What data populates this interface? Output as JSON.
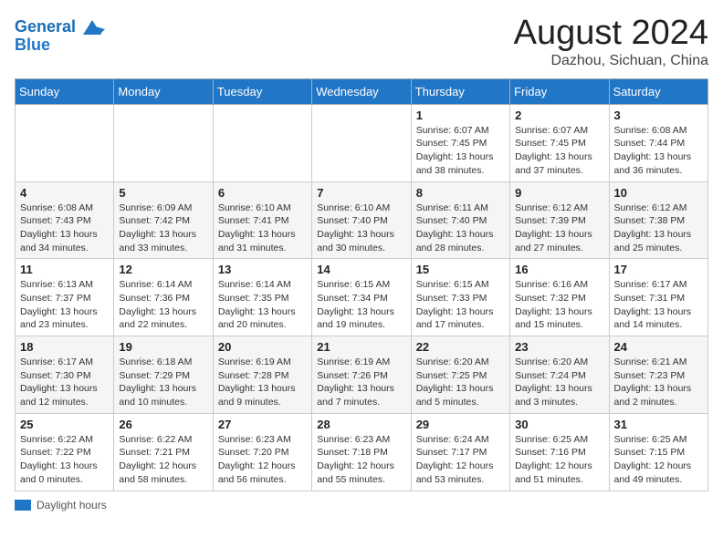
{
  "header": {
    "logo_line1": "General",
    "logo_line2": "Blue",
    "main_title": "August 2024",
    "subtitle": "Dazhou, Sichuan, China"
  },
  "days_of_week": [
    "Sunday",
    "Monday",
    "Tuesday",
    "Wednesday",
    "Thursday",
    "Friday",
    "Saturday"
  ],
  "weeks": [
    [
      {
        "day": "",
        "info": ""
      },
      {
        "day": "",
        "info": ""
      },
      {
        "day": "",
        "info": ""
      },
      {
        "day": "",
        "info": ""
      },
      {
        "day": "1",
        "info": "Sunrise: 6:07 AM\nSunset: 7:45 PM\nDaylight: 13 hours and 38 minutes."
      },
      {
        "day": "2",
        "info": "Sunrise: 6:07 AM\nSunset: 7:45 PM\nDaylight: 13 hours and 37 minutes."
      },
      {
        "day": "3",
        "info": "Sunrise: 6:08 AM\nSunset: 7:44 PM\nDaylight: 13 hours and 36 minutes."
      }
    ],
    [
      {
        "day": "4",
        "info": "Sunrise: 6:08 AM\nSunset: 7:43 PM\nDaylight: 13 hours and 34 minutes."
      },
      {
        "day": "5",
        "info": "Sunrise: 6:09 AM\nSunset: 7:42 PM\nDaylight: 13 hours and 33 minutes."
      },
      {
        "day": "6",
        "info": "Sunrise: 6:10 AM\nSunset: 7:41 PM\nDaylight: 13 hours and 31 minutes."
      },
      {
        "day": "7",
        "info": "Sunrise: 6:10 AM\nSunset: 7:40 PM\nDaylight: 13 hours and 30 minutes."
      },
      {
        "day": "8",
        "info": "Sunrise: 6:11 AM\nSunset: 7:40 PM\nDaylight: 13 hours and 28 minutes."
      },
      {
        "day": "9",
        "info": "Sunrise: 6:12 AM\nSunset: 7:39 PM\nDaylight: 13 hours and 27 minutes."
      },
      {
        "day": "10",
        "info": "Sunrise: 6:12 AM\nSunset: 7:38 PM\nDaylight: 13 hours and 25 minutes."
      }
    ],
    [
      {
        "day": "11",
        "info": "Sunrise: 6:13 AM\nSunset: 7:37 PM\nDaylight: 13 hours and 23 minutes."
      },
      {
        "day": "12",
        "info": "Sunrise: 6:14 AM\nSunset: 7:36 PM\nDaylight: 13 hours and 22 minutes."
      },
      {
        "day": "13",
        "info": "Sunrise: 6:14 AM\nSunset: 7:35 PM\nDaylight: 13 hours and 20 minutes."
      },
      {
        "day": "14",
        "info": "Sunrise: 6:15 AM\nSunset: 7:34 PM\nDaylight: 13 hours and 19 minutes."
      },
      {
        "day": "15",
        "info": "Sunrise: 6:15 AM\nSunset: 7:33 PM\nDaylight: 13 hours and 17 minutes."
      },
      {
        "day": "16",
        "info": "Sunrise: 6:16 AM\nSunset: 7:32 PM\nDaylight: 13 hours and 15 minutes."
      },
      {
        "day": "17",
        "info": "Sunrise: 6:17 AM\nSunset: 7:31 PM\nDaylight: 13 hours and 14 minutes."
      }
    ],
    [
      {
        "day": "18",
        "info": "Sunrise: 6:17 AM\nSunset: 7:30 PM\nDaylight: 13 hours and 12 minutes."
      },
      {
        "day": "19",
        "info": "Sunrise: 6:18 AM\nSunset: 7:29 PM\nDaylight: 13 hours and 10 minutes."
      },
      {
        "day": "20",
        "info": "Sunrise: 6:19 AM\nSunset: 7:28 PM\nDaylight: 13 hours and 9 minutes."
      },
      {
        "day": "21",
        "info": "Sunrise: 6:19 AM\nSunset: 7:26 PM\nDaylight: 13 hours and 7 minutes."
      },
      {
        "day": "22",
        "info": "Sunrise: 6:20 AM\nSunset: 7:25 PM\nDaylight: 13 hours and 5 minutes."
      },
      {
        "day": "23",
        "info": "Sunrise: 6:20 AM\nSunset: 7:24 PM\nDaylight: 13 hours and 3 minutes."
      },
      {
        "day": "24",
        "info": "Sunrise: 6:21 AM\nSunset: 7:23 PM\nDaylight: 13 hours and 2 minutes."
      }
    ],
    [
      {
        "day": "25",
        "info": "Sunrise: 6:22 AM\nSunset: 7:22 PM\nDaylight: 13 hours and 0 minutes."
      },
      {
        "day": "26",
        "info": "Sunrise: 6:22 AM\nSunset: 7:21 PM\nDaylight: 12 hours and 58 minutes."
      },
      {
        "day": "27",
        "info": "Sunrise: 6:23 AM\nSunset: 7:20 PM\nDaylight: 12 hours and 56 minutes."
      },
      {
        "day": "28",
        "info": "Sunrise: 6:23 AM\nSunset: 7:18 PM\nDaylight: 12 hours and 55 minutes."
      },
      {
        "day": "29",
        "info": "Sunrise: 6:24 AM\nSunset: 7:17 PM\nDaylight: 12 hours and 53 minutes."
      },
      {
        "day": "30",
        "info": "Sunrise: 6:25 AM\nSunset: 7:16 PM\nDaylight: 12 hours and 51 minutes."
      },
      {
        "day": "31",
        "info": "Sunrise: 6:25 AM\nSunset: 7:15 PM\nDaylight: 12 hours and 49 minutes."
      }
    ]
  ],
  "footer": {
    "label": "Daylight hours"
  }
}
